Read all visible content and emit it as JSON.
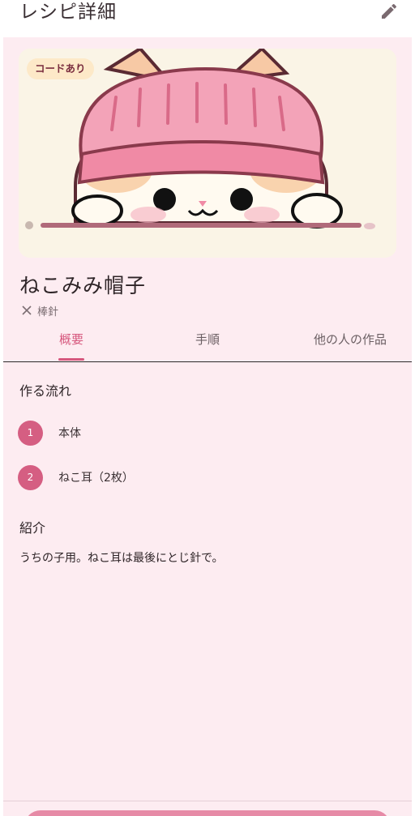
{
  "app_bar": {
    "title": "レシピ詳細",
    "edit_icon": "pencil-icon"
  },
  "hero": {
    "badge": "コードあり",
    "illustration": "cat-wearing-pink-knit-hat"
  },
  "recipe": {
    "title": "ねこみみ帽子",
    "tool_icon": "knitting-needles-icon",
    "tool": "棒針"
  },
  "tabs": [
    {
      "label": "概要",
      "active": true
    },
    {
      "label": "手順",
      "active": false
    },
    {
      "label": "他の人の作品",
      "active": false
    }
  ],
  "flow": {
    "title": "作る流れ",
    "steps": [
      {
        "num": "1",
        "label": "本体"
      },
      {
        "num": "2",
        "label": "ねこ耳（2枚）"
      }
    ]
  },
  "intro": {
    "title": "紹介",
    "text": "うちの子用。ねこ耳は最後にとじ針で。"
  },
  "colors": {
    "accent": "#d6577d",
    "background": "#fdecf1",
    "badge_bg": "#fde9c8"
  }
}
